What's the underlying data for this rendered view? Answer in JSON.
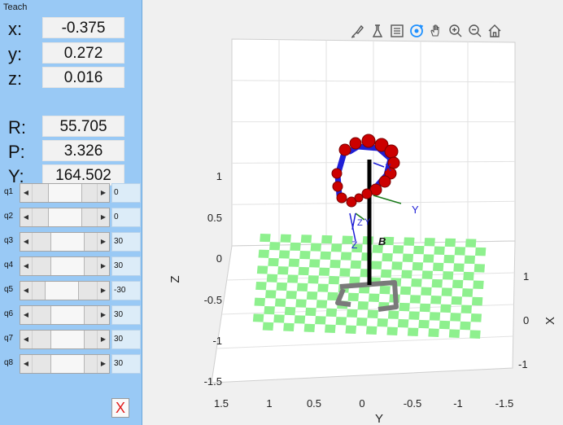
{
  "panel": {
    "title": "Teach",
    "pose": [
      {
        "label": "x:",
        "value": "-0.375"
      },
      {
        "label": "y:",
        "value": "0.272"
      },
      {
        "label": "z:",
        "value": "0.016"
      },
      {
        "label": "R:",
        "value": "55.705"
      },
      {
        "label": "P:",
        "value": "3.326"
      },
      {
        "label": "Y:",
        "value": "164.502"
      }
    ],
    "joints": [
      {
        "label": "q1",
        "value": "0",
        "slider_fraction": 0.5
      },
      {
        "label": "q2",
        "value": "0",
        "slider_fraction": 0.5
      },
      {
        "label": "q3",
        "value": "30",
        "slider_fraction": 0.6
      },
      {
        "label": "q4",
        "value": "30",
        "slider_fraction": 0.6
      },
      {
        "label": "q5",
        "value": "-30",
        "slider_fraction": 0.4
      },
      {
        "label": "q6",
        "value": "30",
        "slider_fraction": 0.6
      },
      {
        "label": "q7",
        "value": "30",
        "slider_fraction": 0.6
      },
      {
        "label": "q8",
        "value": "30",
        "slider_fraction": 0.6
      }
    ],
    "close_label": "X"
  },
  "toolbar": {
    "icons": [
      "brush-icon",
      "data-tip-icon",
      "legend-icon",
      "rotate-3d-icon",
      "pan-hand-icon",
      "zoom-in-icon",
      "zoom-out-icon",
      "home-icon"
    ]
  },
  "axes": {
    "z_label": "Z",
    "y_label": "Y",
    "x_label": "X",
    "z_ticks": [
      "1",
      "0.5",
      "0",
      "-0.5",
      "-1",
      "-1.5"
    ],
    "y_ticks": [
      "1.5",
      "1",
      "0.5",
      "0",
      "-0.5",
      "-1",
      "-1.5"
    ],
    "x_ticks": [
      "1",
      "0",
      "-1"
    ]
  },
  "robot": {
    "base_label": "B",
    "frame_labels": [
      "X",
      "Y",
      "Z",
      "Y",
      "Z"
    ]
  },
  "colors": {
    "panel_bg": "#99c9f5",
    "floor": "#8ef08e",
    "link": "#1f1fd6",
    "joint": "#cc0000",
    "pedestal": "#000000",
    "base": "#7a7a7a",
    "close": "#e01b1b"
  }
}
